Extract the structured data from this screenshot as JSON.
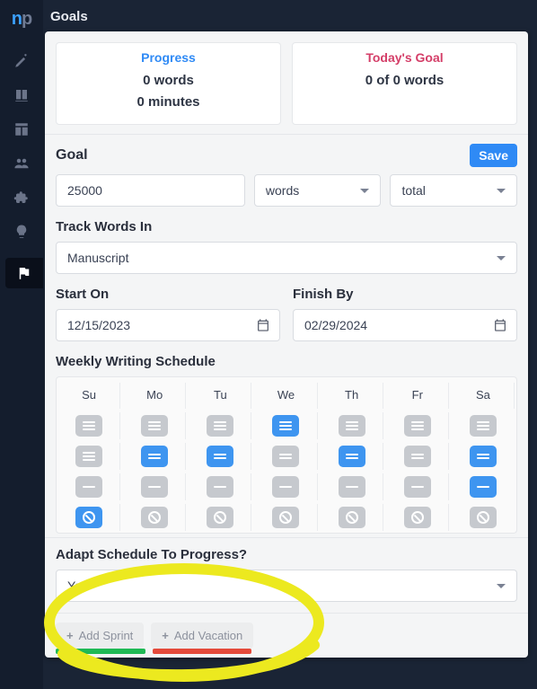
{
  "page_title": "Goals",
  "logo": {
    "n": "n",
    "p": "p"
  },
  "stats": {
    "progress": {
      "title": "Progress",
      "line1": "0 words",
      "line2": "0 minutes"
    },
    "today": {
      "title": "Today's Goal",
      "line1": "0 of 0 words"
    }
  },
  "goal": {
    "label": "Goal",
    "save": "Save",
    "amount": "25000",
    "unit": "words",
    "scope": "total"
  },
  "track": {
    "label": "Track Words In",
    "value": "Manuscript"
  },
  "dates": {
    "start_label": "Start On",
    "start": "12/15/2023",
    "finish_label": "Finish By",
    "finish": "02/29/2024"
  },
  "schedule": {
    "label": "Weekly Writing Schedule",
    "days": [
      "Su",
      "Mo",
      "Tu",
      "We",
      "Th",
      "Fr",
      "Sa"
    ],
    "grid": [
      [
        "gray-lines",
        "gray-lines",
        "gray-lines",
        "blue-lines",
        "gray-lines",
        "gray-lines",
        "gray-lines"
      ],
      [
        "gray-lines",
        "blue-two",
        "blue-two",
        "gray-two",
        "blue-two",
        "gray-two",
        "blue-two"
      ],
      [
        "gray-one",
        "gray-one",
        "gray-one",
        "gray-one",
        "gray-one",
        "gray-one",
        "blue-one"
      ],
      [
        "blue-ban",
        "gray-ban",
        "gray-ban",
        "gray-ban",
        "gray-ban",
        "gray-ban",
        "gray-ban"
      ]
    ]
  },
  "adapt": {
    "label": "Adapt Schedule To Progress?",
    "value": "Yes"
  },
  "footer": {
    "add_sprint": "Add Sprint",
    "add_vacation": "Add Vacation"
  }
}
